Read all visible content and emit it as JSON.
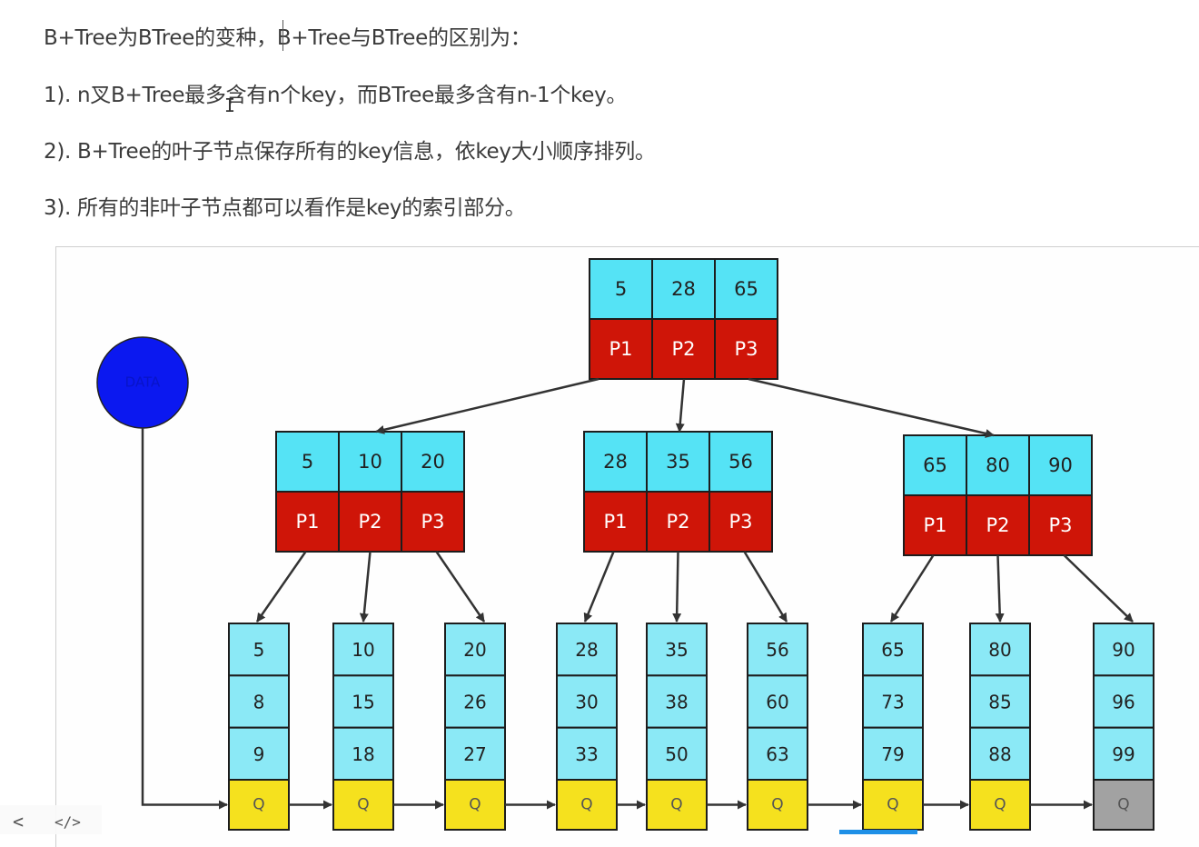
{
  "lines": [
    "B+Tree为BTree的变种，B+Tree与BTree的区别为：",
    "1). n叉B+Tree最多含有n个key，而BTree最多含有n-1个key。",
    "2). B+Tree的叶子节点保存所有的key信息，依key大小顺序排列。",
    "3). 所有的非叶子节点都可以看作是key的索引部分。"
  ],
  "tree": {
    "data_label": "DATA",
    "pointer_label": "Q",
    "root": {
      "keys": [
        "5",
        "28",
        "65"
      ],
      "pointers": [
        "P1",
        "P2",
        "P3"
      ]
    },
    "internal": [
      {
        "keys": [
          "5",
          "10",
          "20"
        ],
        "pointers": [
          "P1",
          "P2",
          "P3"
        ]
      },
      {
        "keys": [
          "28",
          "35",
          "56"
        ],
        "pointers": [
          "P1",
          "P2",
          "P3"
        ]
      },
      {
        "keys": [
          "65",
          "80",
          "90"
        ],
        "pointers": [
          "P1",
          "P2",
          "P3"
        ]
      }
    ],
    "leaves": [
      [
        "5",
        "8",
        "9"
      ],
      [
        "10",
        "15",
        "18"
      ],
      [
        "20",
        "26",
        "27"
      ],
      [
        "28",
        "30",
        "33"
      ],
      [
        "35",
        "38",
        "50"
      ],
      [
        "56",
        "60",
        "63"
      ],
      [
        "65",
        "73",
        "79"
      ],
      [
        "80",
        "85",
        "88"
      ],
      [
        "90",
        "96",
        "99"
      ]
    ],
    "colors": {
      "key_fill": "#55e3f5",
      "pointer_fill": "#cf1508",
      "leaf_fill": "#8be9f6",
      "leaf_pointer_fill": "#f5e11e",
      "last_pointer_fill": "#a2a2a2",
      "data_fill": "#0b18f0"
    }
  },
  "footer": {
    "back_icon": "<",
    "code_icon": "</>"
  }
}
